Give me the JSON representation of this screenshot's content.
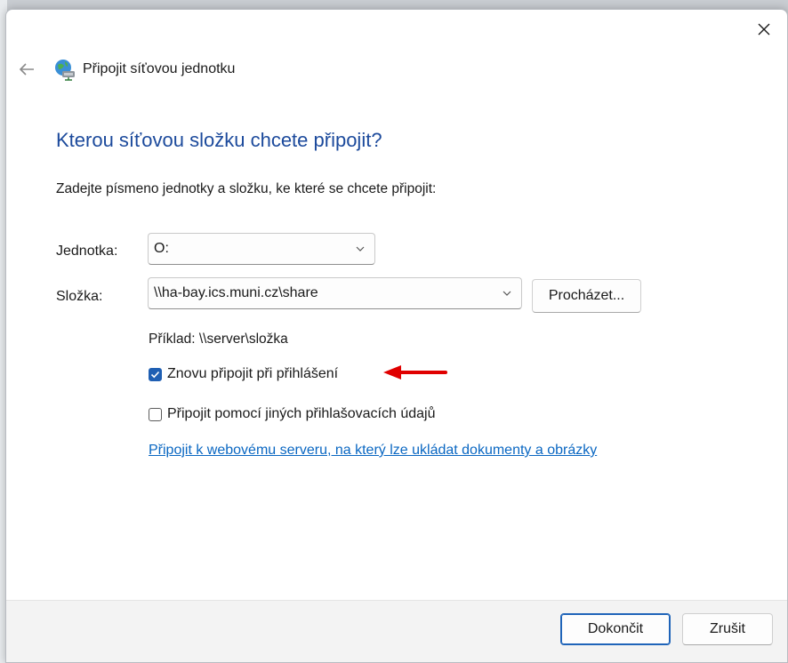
{
  "window": {
    "title": "Připojit síťovou jednotku",
    "close_icon": "close-icon",
    "back_icon": "back-arrow-icon",
    "app_icon": "network-drive-icon"
  },
  "content": {
    "heading": "Kterou síťovou složku chcete připojit?",
    "instruction": "Zadejte písmeno jednotky a složku, ke které se chcete připojit:",
    "drive_label": "Jednotka:",
    "drive_value": "O:",
    "folder_label": "Složka:",
    "folder_value": "\\\\ha-bay.ics.muni.cz\\share",
    "browse_label": "Procházet...",
    "example": "Příklad: \\\\server\\složka",
    "reconnect_label": "Znovu připojit při přihlášení",
    "reconnect_checked": true,
    "other_credentials_label": "Připojit pomocí jiných přihlašovacích údajů",
    "other_credentials_checked": false,
    "web_link": "Připojit k webovému serveru, na který lze ukládat dokumenty a obrázky"
  },
  "footer": {
    "finish_label": "Dokončit",
    "cancel_label": "Zrušit"
  },
  "colors": {
    "heading": "#1c4a9c",
    "accent": "#1f5fb3",
    "link": "#0a67c2",
    "annotation_arrow": "#e00000"
  }
}
